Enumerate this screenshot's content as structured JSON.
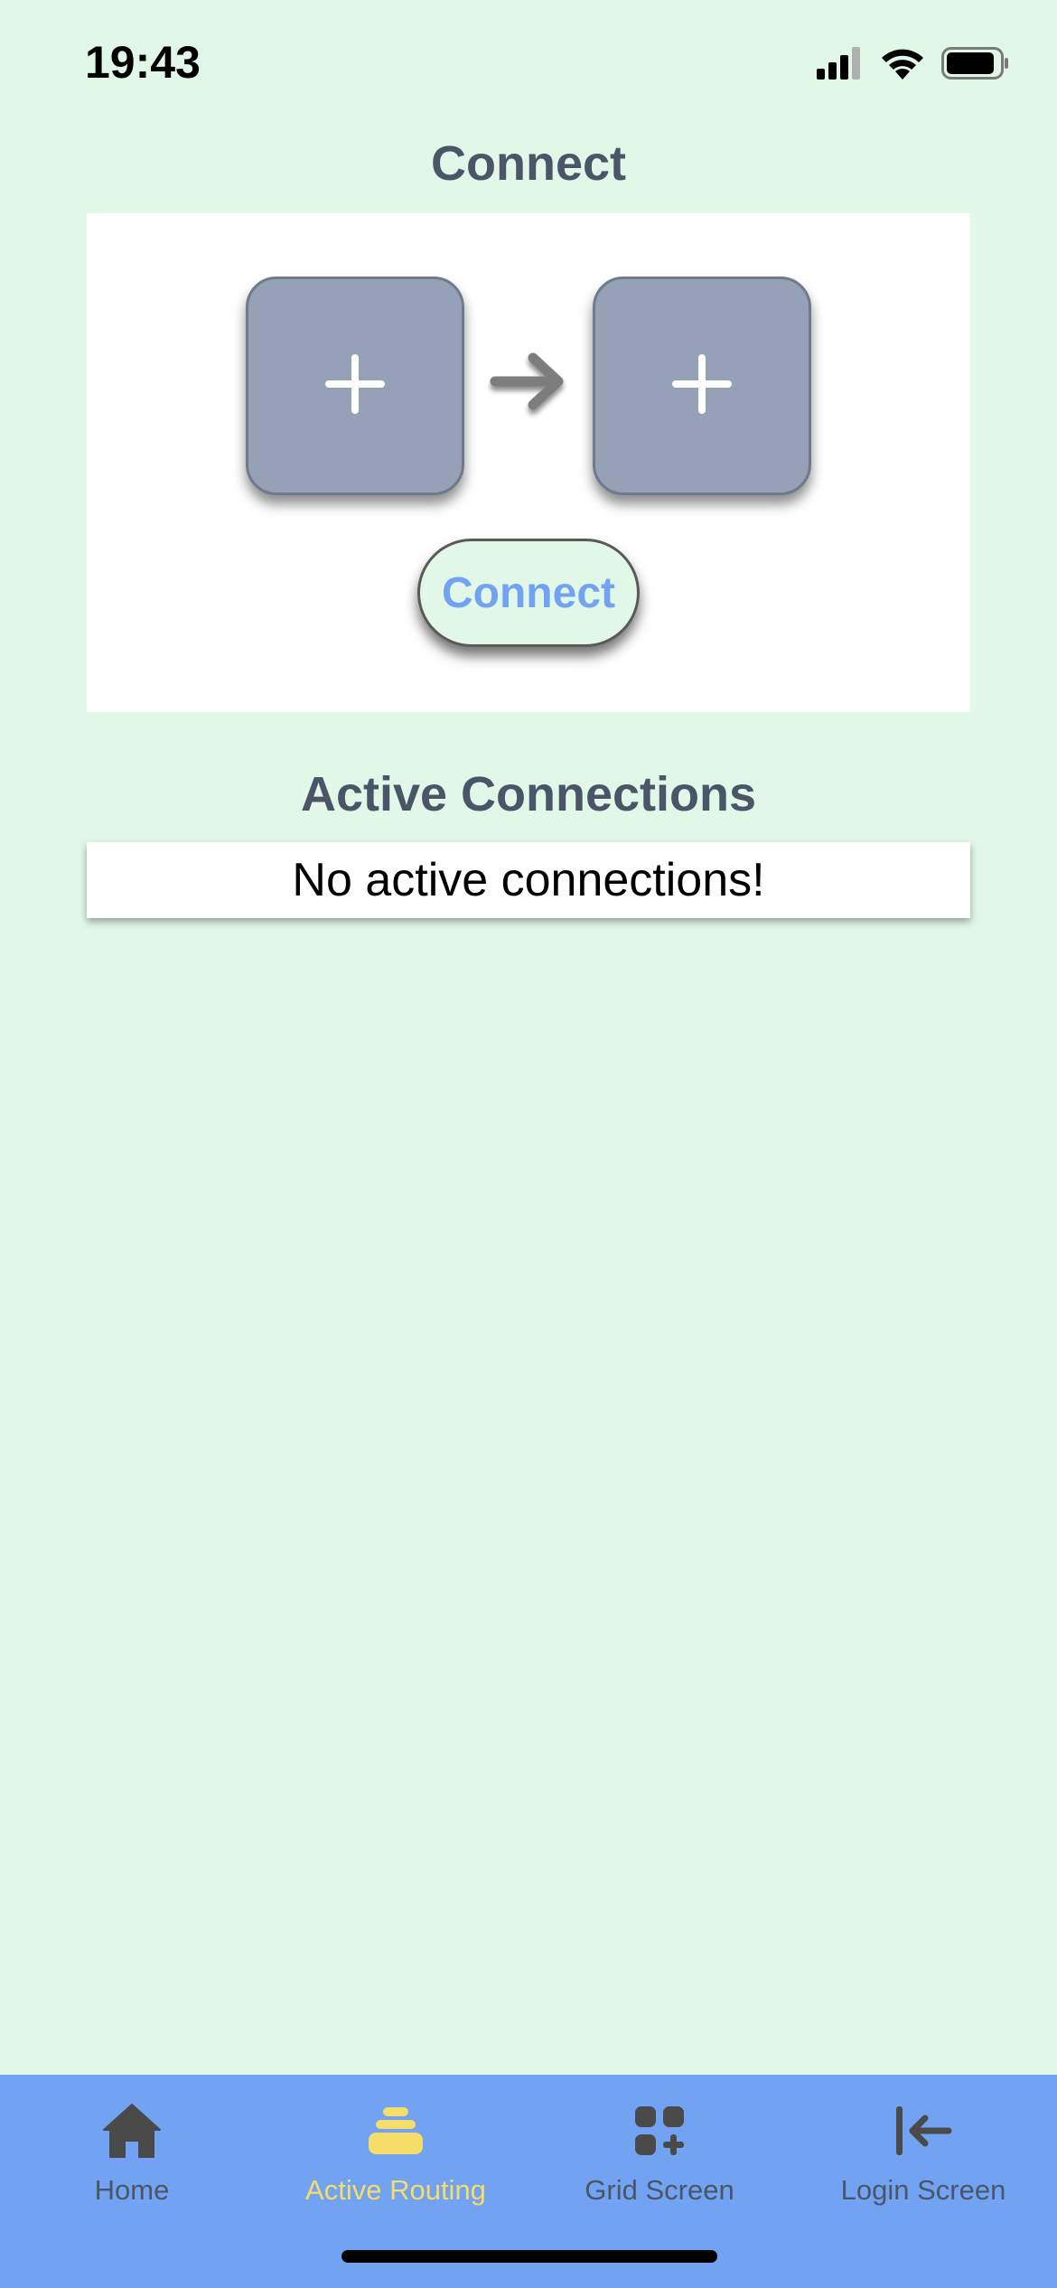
{
  "status_bar": {
    "time": "19:43",
    "signal_icon": "cellular-signal-icon",
    "wifi_icon": "wifi-icon",
    "battery_icon": "battery-icon"
  },
  "connect_section": {
    "title": "Connect",
    "source_slot_icon": "plus-icon",
    "target_slot_icon": "plus-icon",
    "arrow_icon": "arrow-right-icon",
    "connect_button_label": "Connect"
  },
  "active_section": {
    "title": "Active Connections",
    "empty_message": "No active connections!"
  },
  "tab_bar": {
    "active_tab": "Active Routing",
    "tabs": [
      {
        "label": "Home",
        "icon": "home-icon"
      },
      {
        "label": "Active Routing",
        "icon": "stack-icon"
      },
      {
        "label": "Grid Screen",
        "icon": "grid-add-icon"
      },
      {
        "label": "Login Screen",
        "icon": "arrow-left-to-line-icon"
      }
    ]
  },
  "colors": {
    "background": "#e1f8e8",
    "tab_bar": "#72a3f2",
    "active_tab": "#f6dc68",
    "slot": "#95a1b6",
    "title_text": "#4a5568",
    "button_text": "#72a3f2"
  }
}
